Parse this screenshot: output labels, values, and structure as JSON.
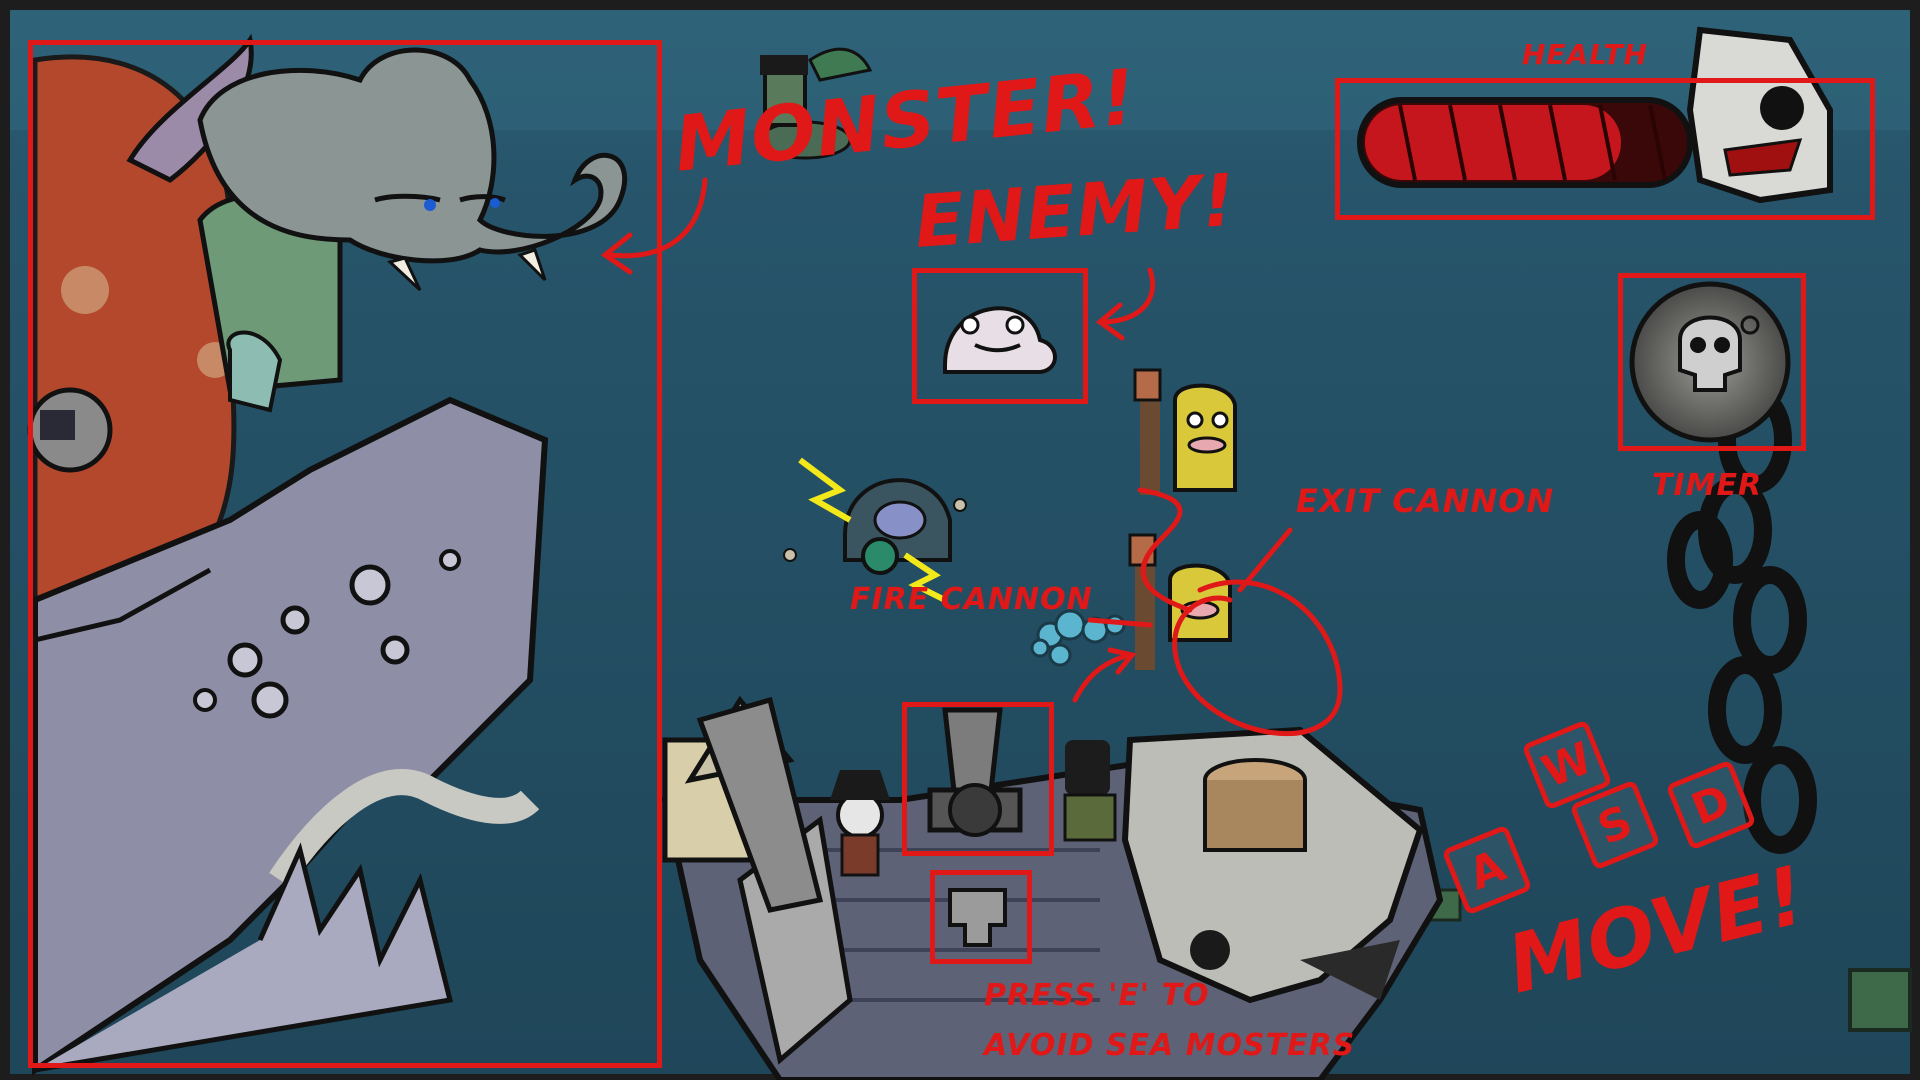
{
  "hud": {
    "health_label": "HEALTH",
    "health_level": 0.8,
    "timer_label": "TIMER"
  },
  "annotations": {
    "monster": "MONSTER!",
    "enemy": "ENEMY!",
    "exit_cannon": "EXIT CANNON",
    "fire_cannon": "FIRE CANNON",
    "press_e_line1": "PRESS 'E' TO",
    "press_e_line2": "AVOID SEA MOSTERS",
    "move": "MOVE!"
  },
  "controls": {
    "keys": [
      "W",
      "A",
      "S",
      "D"
    ]
  },
  "colors": {
    "annotation_red": "#e01818",
    "sea": "#264d60",
    "health_fill": "#c4161c"
  }
}
